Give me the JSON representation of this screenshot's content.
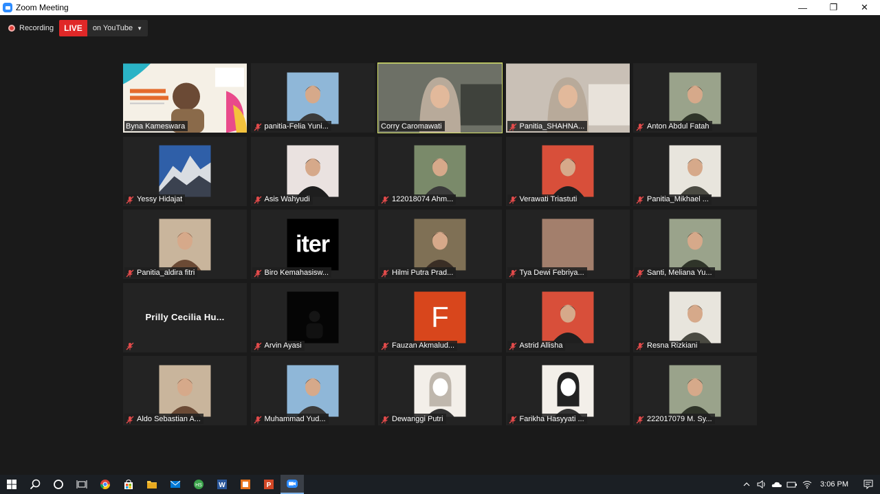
{
  "window": {
    "title": "Zoom Meeting",
    "minimize_glyph": "—",
    "restore_glyph": "❐",
    "close_glyph": "✕"
  },
  "recording": {
    "label": "Recording"
  },
  "live": {
    "badge": "LIVE",
    "target": "on YouTube"
  },
  "participants": [
    {
      "name": "Byna Kameswara",
      "muted": false,
      "active": false,
      "video": "webinar-banner"
    },
    {
      "name": "panitia-Felia Yuni...",
      "muted": true,
      "active": false,
      "video": "photo"
    },
    {
      "name": "Corry Caromawati",
      "muted": false,
      "active": true,
      "video": "camera"
    },
    {
      "name": "Panitia_SHAHNA...",
      "muted": true,
      "active": false,
      "video": "camera"
    },
    {
      "name": "Anton Abdul Fatah",
      "muted": true,
      "active": false,
      "video": "photo"
    },
    {
      "name": "Yessy Hidajat",
      "muted": true,
      "active": false,
      "video": "mountain"
    },
    {
      "name": "Asis Wahyudi",
      "muted": true,
      "active": false,
      "video": "photo"
    },
    {
      "name": "122018074 Ahm...",
      "muted": true,
      "active": false,
      "video": "photo"
    },
    {
      "name": "Verawati Triastuti",
      "muted": true,
      "active": false,
      "video": "photo"
    },
    {
      "name": "Panitia_Mikhael ...",
      "muted": true,
      "active": false,
      "video": "photo"
    },
    {
      "name": "Panitia_aldira fitri",
      "muted": true,
      "active": false,
      "video": "photo"
    },
    {
      "name": "Biro Kemahasisw...",
      "muted": true,
      "active": false,
      "video": "iter-logo",
      "logo_text": "iter"
    },
    {
      "name": "Hilmi Putra Prad...",
      "muted": true,
      "active": false,
      "video": "photo"
    },
    {
      "name": "Tya Dewi Febriya...",
      "muted": true,
      "active": false,
      "video": "plain"
    },
    {
      "name": "Santi, Meliana Yu...",
      "muted": true,
      "active": false,
      "video": "photo"
    },
    {
      "name": "",
      "display_name": "Prilly  Cecilia  Hu...",
      "muted": true,
      "active": false,
      "video": "none"
    },
    {
      "name": "Arvin Ayasi",
      "muted": true,
      "active": false,
      "video": "dark"
    },
    {
      "name": "Fauzan Akmalud...",
      "muted": true,
      "active": false,
      "video": "initial",
      "initial": "F"
    },
    {
      "name": "Astrid Allisha",
      "muted": true,
      "active": false,
      "video": "photo"
    },
    {
      "name": "Resna Rizkiani",
      "muted": true,
      "active": false,
      "video": "photo"
    },
    {
      "name": "Aldo Sebastian A...",
      "muted": true,
      "active": false,
      "video": "photo"
    },
    {
      "name": "Muhammad Yud...",
      "muted": true,
      "active": false,
      "video": "photo"
    },
    {
      "name": "Dewanggi Putri",
      "muted": true,
      "active": false,
      "video": "illustration"
    },
    {
      "name": "Farikha Hasyyati ...",
      "muted": true,
      "active": false,
      "video": "illustration"
    },
    {
      "name": "222017079 M. Sy...",
      "muted": true,
      "active": false,
      "video": "photo"
    }
  ],
  "taskbar": {
    "apps": [
      "windows-icon",
      "search-icon",
      "cortana-icon",
      "task-view-icon",
      "chrome-icon",
      "store-icon",
      "file-explorer-icon",
      "mail-icon",
      "app-icon",
      "word-icon",
      "app-icon-orange",
      "powerpoint-icon",
      "zoom-icon"
    ],
    "clock": "3:06 PM"
  },
  "colors": {
    "live_red": "#e02828",
    "active_speaker": "#d7e36a",
    "mute_red": "#e04a4a",
    "zoom_blue": "#2d8cff"
  }
}
